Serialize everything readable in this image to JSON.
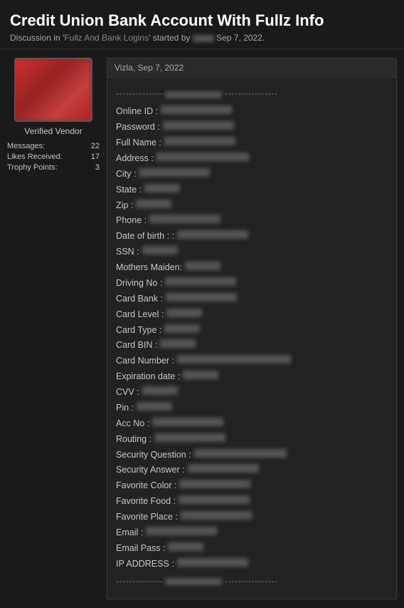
{
  "header": {
    "title": "Credit Union Bank Account With Fullz Info",
    "subtitle_prefix": "Discussion in '",
    "forum_name": "Fullz And Bank Logins",
    "subtitle_mid": "' started by ",
    "author": "███",
    "date": "Sep 7, 2022."
  },
  "sidebar": {
    "vendor_label": "Verified Vendor",
    "stats": [
      {
        "label": "Messages:",
        "value": "22"
      },
      {
        "label": "Likes Received:",
        "value": "17"
      },
      {
        "label": "Trophy Points:",
        "value": "3"
      }
    ]
  },
  "post": {
    "author_date": "Vizla, Sep 7, 2022",
    "fields": [
      {
        "label": "Online ID :",
        "value_size": "medium"
      },
      {
        "label": "Password :",
        "value_size": "medium"
      },
      {
        "label": "Full Name :",
        "value_size": "medium"
      },
      {
        "label": "Address :",
        "value_size": "long"
      },
      {
        "label": "City :",
        "value_size": "medium"
      },
      {
        "label": "State :",
        "value_size": "short"
      },
      {
        "label": "Zip :",
        "value_size": "short"
      },
      {
        "label": "Phone :",
        "value_size": "medium"
      },
      {
        "label": "Date of birth : :",
        "value_size": "medium"
      },
      {
        "label": "SSN :",
        "value_size": "short"
      },
      {
        "label": "Mothers Maiden:",
        "value_size": "short"
      },
      {
        "label": "Driving No :",
        "value_size": "medium"
      },
      {
        "label": "Card Bank :",
        "value_size": "medium"
      },
      {
        "label": "Card Level :",
        "value_size": "short"
      },
      {
        "label": "Card Type :",
        "value_size": "short"
      },
      {
        "label": "Card BIN :",
        "value_size": "short"
      },
      {
        "label": "Card Number :",
        "value_size": "xlong"
      },
      {
        "label": "Expiration date :",
        "value_size": "short"
      },
      {
        "label": "CVV :",
        "value_size": "short"
      },
      {
        "label": "Pin :",
        "value_size": "short"
      },
      {
        "label": "Acc No :",
        "value_size": "medium"
      },
      {
        "label": "Routing :",
        "value_size": "medium"
      },
      {
        "label": "Security Question :",
        "value_size": "long"
      },
      {
        "label": "Security Answer :",
        "value_size": "medium"
      },
      {
        "label": "Favorite Color :",
        "value_size": "medium"
      },
      {
        "label": "Favorite Food :",
        "value_size": "medium"
      },
      {
        "label": "Favorite Place :",
        "value_size": "medium"
      },
      {
        "label": "Email :",
        "value_size": "medium"
      },
      {
        "label": "Email Pass :",
        "value_size": "short"
      },
      {
        "label": "IP ADDRESS :",
        "value_size": "medium"
      }
    ]
  }
}
